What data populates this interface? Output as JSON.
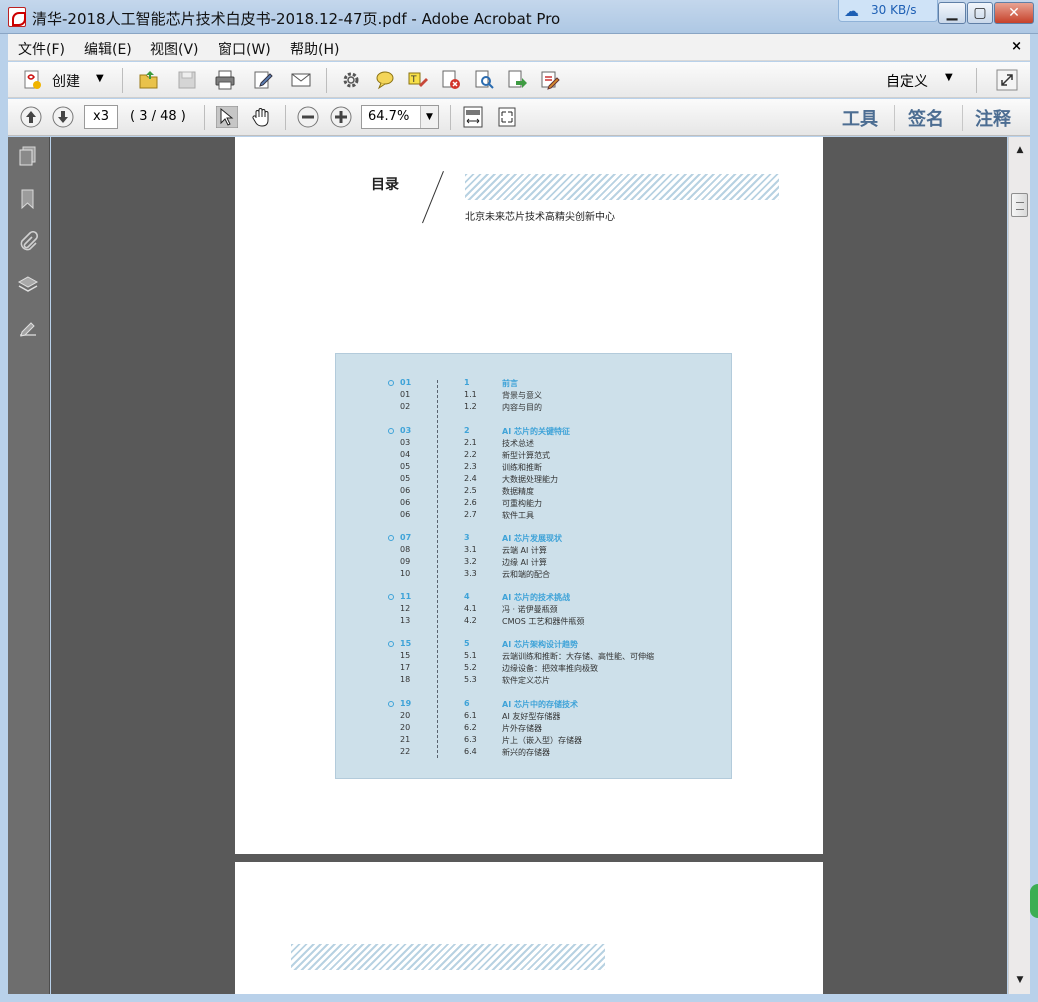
{
  "window": {
    "title": "清华-2018人工智能芯片技术白皮书-2018.12-47页.pdf - Adobe Acrobat Pro",
    "net_rate": "30 KB/s",
    "min_glyph": "▁",
    "max_glyph": "▢",
    "close_glyph": "✕"
  },
  "menu": {
    "items": [
      "文件(F)",
      "编辑(E)",
      "视图(V)",
      "窗口(W)",
      "帮助(H)"
    ],
    "close_glyph": "×"
  },
  "toolbar": {
    "create_label": "创建",
    "dropdown_glyph": "▼",
    "custom_label": "自定义"
  },
  "nav": {
    "page_value": "x3",
    "page_count": "( 3 / 48 )",
    "zoom_value": "64.7%",
    "right_links": [
      "工具",
      "签名",
      "注释"
    ]
  },
  "page": {
    "toc_title": "目录",
    "org": "北京未来芯片技术高精尖创新中心",
    "toc": [
      {
        "page": "01",
        "num": "1",
        "text": "前言",
        "heading": true
      },
      {
        "page": "01",
        "num": "1.1",
        "text": "背景与意义"
      },
      {
        "page": "02",
        "num": "1.2",
        "text": "内容与目的"
      },
      {
        "page": "03",
        "num": "2",
        "text": "AI 芯片的关键特征",
        "heading": true
      },
      {
        "page": "03",
        "num": "2.1",
        "text": "技术总述"
      },
      {
        "page": "04",
        "num": "2.2",
        "text": "新型计算范式"
      },
      {
        "page": "05",
        "num": "2.3",
        "text": "训练和推断"
      },
      {
        "page": "05",
        "num": "2.4",
        "text": "大数据处理能力"
      },
      {
        "page": "06",
        "num": "2.5",
        "text": "数据精度"
      },
      {
        "page": "06",
        "num": "2.6",
        "text": "可重构能力"
      },
      {
        "page": "06",
        "num": "2.7",
        "text": "软件工具"
      },
      {
        "page": "07",
        "num": "3",
        "text": "AI 芯片发展现状",
        "heading": true
      },
      {
        "page": "08",
        "num": "3.1",
        "text": "云端 AI 计算"
      },
      {
        "page": "09",
        "num": "3.2",
        "text": "边缘 AI 计算"
      },
      {
        "page": "10",
        "num": "3.3",
        "text": "云和端的配合"
      },
      {
        "page": "11",
        "num": "4",
        "text": "AI 芯片的技术挑战",
        "heading": true
      },
      {
        "page": "12",
        "num": "4.1",
        "text": "冯 · 诺伊曼瓶颈"
      },
      {
        "page": "13",
        "num": "4.2",
        "text": "CMOS 工艺和器件瓶颈"
      },
      {
        "page": "15",
        "num": "5",
        "text": "AI 芯片架构设计趋势",
        "heading": true
      },
      {
        "page": "15",
        "num": "5.1",
        "text": "云端训练和推断：大存储、高性能、可伸缩"
      },
      {
        "page": "17",
        "num": "5.2",
        "text": "边缘设备：把效率推向极致"
      },
      {
        "page": "18",
        "num": "5.3",
        "text": "软件定义芯片"
      },
      {
        "page": "19",
        "num": "6",
        "text": "AI 芯片中的存储技术",
        "heading": true
      },
      {
        "page": "20",
        "num": "6.1",
        "text": "AI 友好型存储器"
      },
      {
        "page": "20",
        "num": "6.2",
        "text": "片外存储器"
      },
      {
        "page": "21",
        "num": "6.3",
        "text": "片上（嵌入型）存储器"
      },
      {
        "page": "22",
        "num": "6.4",
        "text": "新兴的存储器"
      }
    ]
  },
  "scroll": {
    "up_glyph": "▲",
    "down_glyph": "▼"
  }
}
